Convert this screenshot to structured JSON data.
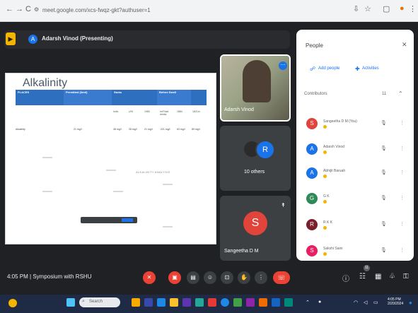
{
  "browser": {
    "url": "meet.google.com/xcs-fwqz-gkt?authuser=1",
    "nav_back": "←",
    "nav_forward": "→",
    "nav_reload": "C"
  },
  "presenting": {
    "avatar_initial": "A",
    "title": "Adarsh Vinod (Presenting)"
  },
  "slide": {
    "title": "Alkalinity",
    "table_headers": [
      "PLACES",
      "Permitted (limit)",
      "Stubs",
      "Before Dwell",
      ""
    ],
    "subheaders": [
      "Indic",
      "USt",
      "1980",
      "Inf/Total drinks",
      "1884",
      "1821m"
    ],
    "row_label": "Alkalinity",
    "row_values": [
      "21 mg/l",
      "48 mg/l",
      "28 mg/l",
      "21 mg/l",
      "221 mg/l",
      "63 mg/l",
      "89 mg/l"
    ],
    "caption": "ALKALINITY ANALYSIS"
  },
  "tiles": {
    "t1_name": "Adarsh Vinod",
    "t2_initial": "R",
    "t2_name": "10 others",
    "t3_initial": "S",
    "t3_name": "Sangeetha D M"
  },
  "people": {
    "title": "People",
    "add_people": "Add people",
    "activities": "Activities",
    "contributors_label": "Contributors",
    "contributors_count": "11",
    "list": [
      {
        "initial": "S",
        "name": "Sangeetha D M (You)",
        "color": "#e0443a"
      },
      {
        "initial": "A",
        "name": "Adarsh Vinod",
        "color": "#1a73e8"
      },
      {
        "initial": "A",
        "name": "Abhijit Baruah",
        "color": "#1a73e8"
      },
      {
        "initial": "G",
        "name": "G K",
        "color": "#2e8b57"
      },
      {
        "initial": "R",
        "name": "R K K",
        "color": "#7b1f2a"
      },
      {
        "initial": "S",
        "name": "Sakshi Saini",
        "color": "#e91e63"
      }
    ]
  },
  "meeting": {
    "time": "4:05 PM",
    "separator": "|",
    "name": "Symposium with RSHU",
    "participant_badge": "11"
  },
  "taskbar": {
    "search_placeholder": "Search",
    "time": "4:05 PM",
    "date": "2/20/2024"
  },
  "colors": {
    "meet_bg": "#202124",
    "accent": "#1a73e8",
    "end_call": "#ea4335",
    "slide_header": "#2f6fbf"
  }
}
